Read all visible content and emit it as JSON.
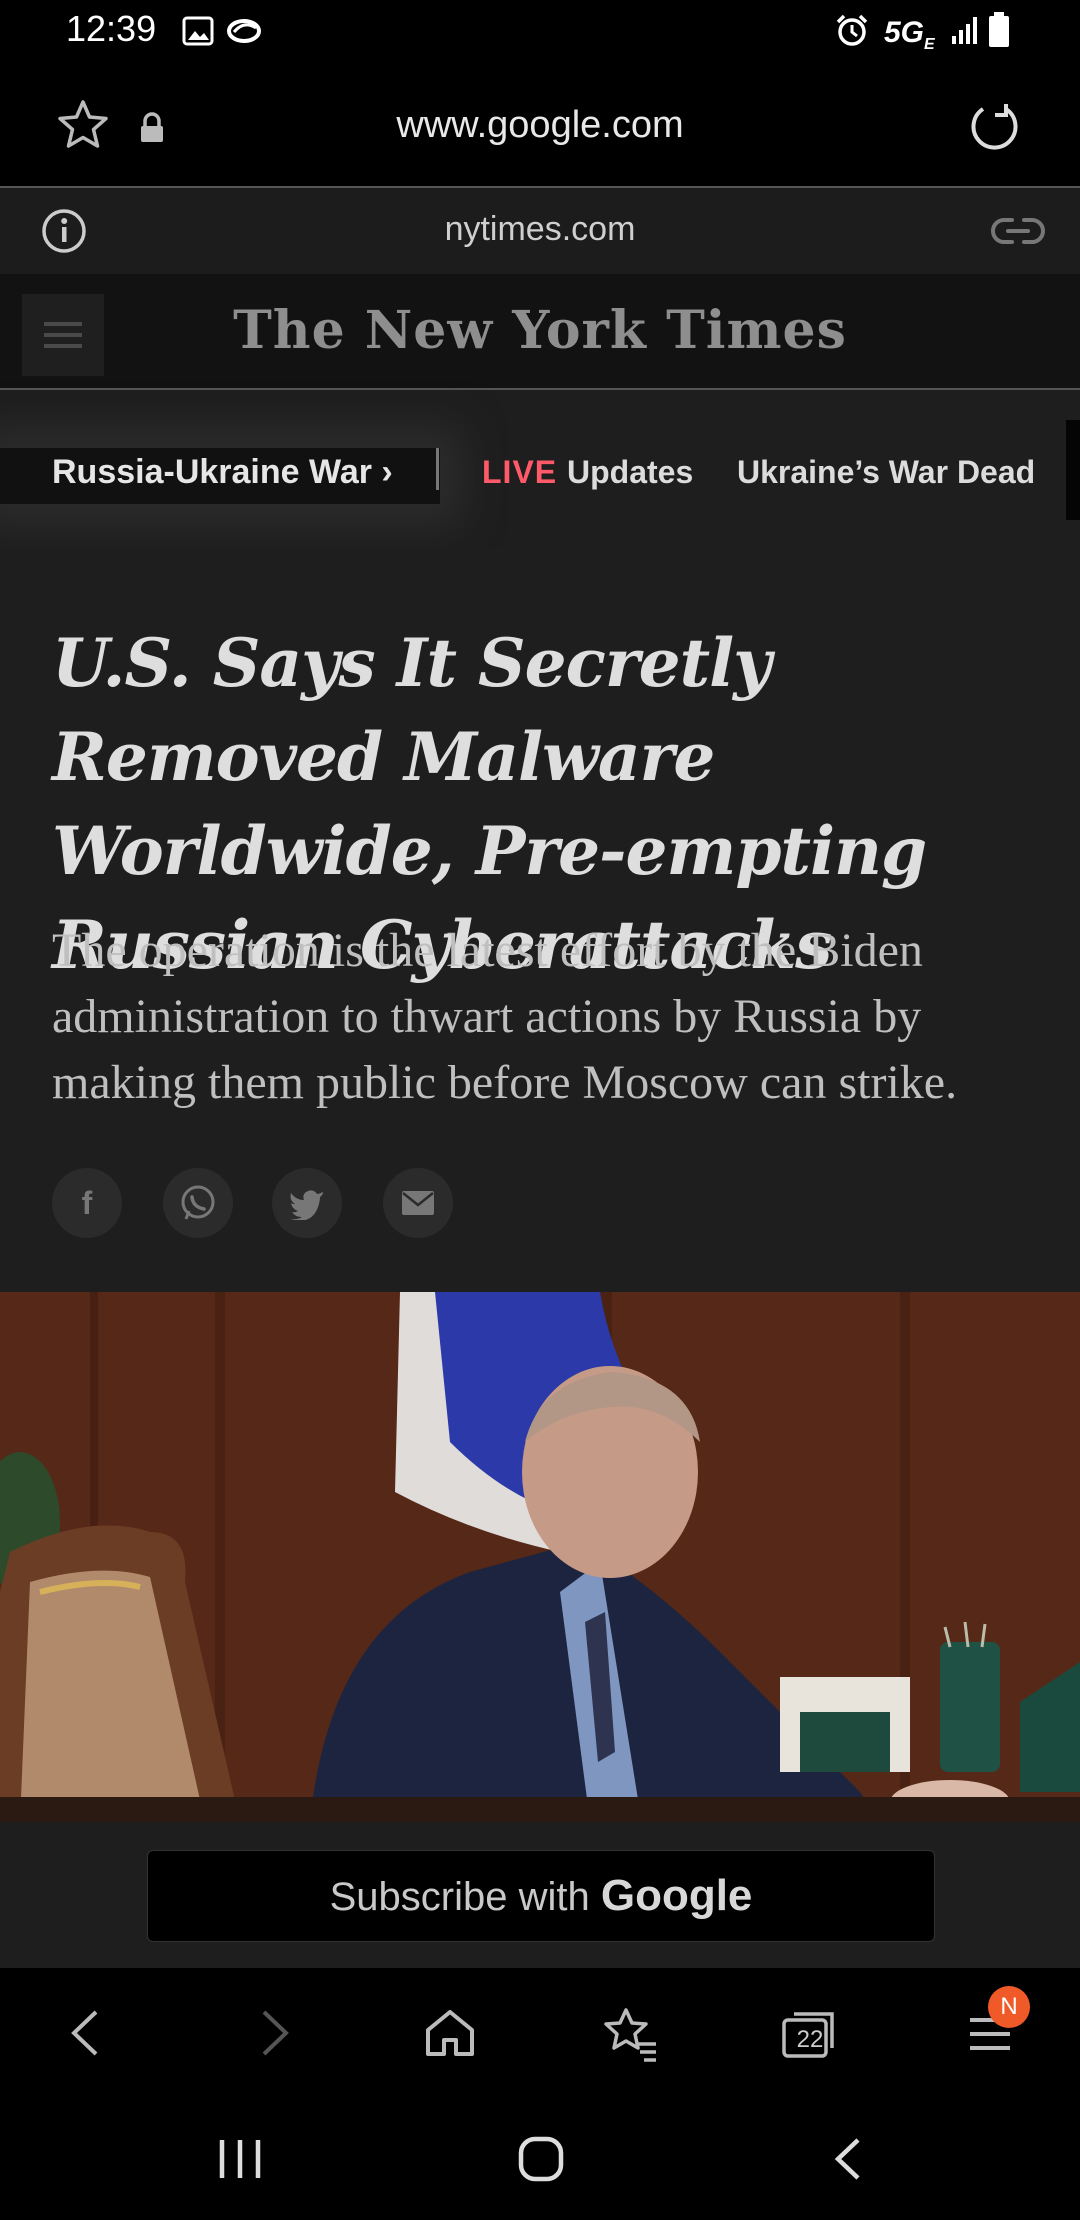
{
  "status_bar": {
    "time": "12:39",
    "network": "5G",
    "network_sub": "E"
  },
  "browser": {
    "url": "www.google.com"
  },
  "site_info": {
    "domain": "nytimes.com"
  },
  "nyt": {
    "masthead": "The New York Times",
    "topics": {
      "main": "Russia-Ukraine War",
      "live": "LIVE",
      "updates": "Updates",
      "war_dead": "Ukraine’s War Dead"
    },
    "article": {
      "headline": "U.S. Says It Secretly Removed Malware Worldwide, Pre-empting Russian Cyberattacks",
      "summary": "The operation is the latest effort by the Biden administration to thwart actions by Russia by making them public before Moscow can strike."
    },
    "share_icons": [
      "facebook-icon",
      "whatsapp-icon",
      "twitter-icon",
      "email-icon"
    ],
    "photo_desc": "article photo"
  },
  "subscribe": {
    "prefix": "Subscribe with",
    "brand": "Google"
  },
  "toolbar": {
    "tabs_count": "22",
    "notification_badge": "N"
  },
  "colors": {
    "live": "#ff5a6a",
    "badge": "#f05a28"
  }
}
